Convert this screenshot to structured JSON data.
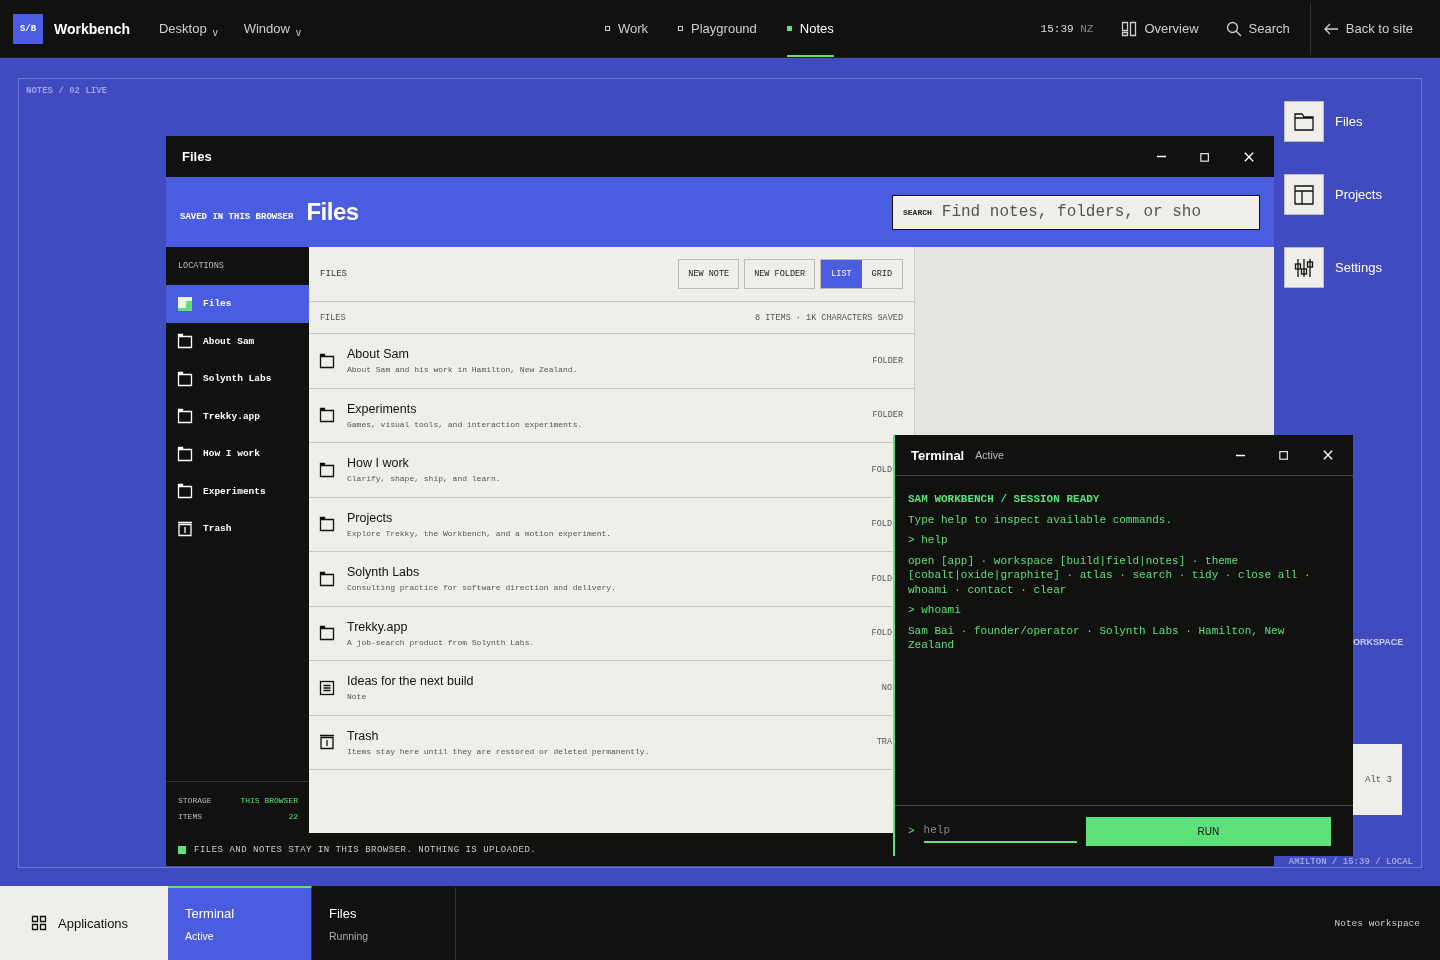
{
  "topbar": {
    "logo": "S/B",
    "title": "Workbench",
    "menus": [
      {
        "label": "Desktop",
        "caret": "v"
      },
      {
        "label": "Window",
        "caret": "v"
      }
    ],
    "nav": [
      {
        "label": "Work",
        "selected": false
      },
      {
        "label": "Playground",
        "selected": false
      },
      {
        "label": "Notes",
        "selected": true
      }
    ],
    "clock": {
      "time": "15:39",
      "zone": "NZ"
    },
    "actions": [
      {
        "label": "Overview",
        "kind": "overview"
      },
      {
        "label": "Search",
        "kind": "search"
      },
      {
        "label": "Back to site",
        "kind": "back"
      }
    ]
  },
  "desktop": {
    "breadcrumb": "NOTES / 02 LIVE",
    "icons": [
      {
        "label": "Files",
        "kind": "folder"
      },
      {
        "label": "Projects",
        "kind": "layout"
      },
      {
        "label": "Settings",
        "kind": "sliders"
      }
    ],
    "cut_label": "ORKSPACE",
    "shortcut": "Alt 3",
    "footer": "AMILTON / 15:39 / LOCAL"
  },
  "files_window": {
    "title": "Files",
    "eyebrow": "SAVED IN THIS BROWSER",
    "heading": "Files",
    "search": {
      "label": "SEARCH",
      "placeholder": "Find notes, folders, or sho"
    },
    "sidebar": {
      "heading": "LOCATIONS",
      "items": [
        {
          "label": "Files",
          "kind": "files",
          "selected": true
        },
        {
          "label": "About Sam",
          "kind": "folder",
          "selected": false
        },
        {
          "label": "Solynth Labs",
          "kind": "folder",
          "selected": false
        },
        {
          "label": "Trekky.app",
          "kind": "folder",
          "selected": false
        },
        {
          "label": "How I work",
          "kind": "folder",
          "selected": false
        },
        {
          "label": "Experiments",
          "kind": "folder",
          "selected": false
        },
        {
          "label": "Trash",
          "kind": "trash",
          "selected": false
        }
      ],
      "storage": [
        {
          "label": "STORAGE",
          "value": "THIS BROWSER"
        },
        {
          "label": "ITEMS",
          "value": "22"
        }
      ]
    },
    "toolbar": {
      "title": "FILES",
      "buttons": [
        "NEW NOTE",
        "NEW FOLDER"
      ],
      "views": [
        {
          "label": "LIST",
          "selected": true
        },
        {
          "label": "GRID",
          "selected": false
        }
      ]
    },
    "list_header": {
      "title": "FILES",
      "summary": "8 ITEMS · 1K CHARACTERS SAVED"
    },
    "rows": [
      {
        "name": "About Sam",
        "description": "About Sam and his work in Hamilton, New Zealand.",
        "type": "FOLDER",
        "kind": "folder",
        "clipped": false
      },
      {
        "name": "Experiments",
        "description": "Games, visual tools, and interaction experiments.",
        "type": "FOLDER",
        "kind": "folder",
        "clipped": false
      },
      {
        "name": "How I work",
        "description": "Clarify, shape, ship, and learn.",
        "type": "FOLD",
        "kind": "folder",
        "clipped": true
      },
      {
        "name": "Projects",
        "description": "Explore Trekky, the Workbench, and a motion experiment.",
        "type": "FOLD",
        "kind": "folder",
        "clipped": true
      },
      {
        "name": "Solynth Labs",
        "description": "Consulting practice for software direction and delivery.",
        "type": "FOLD",
        "kind": "folder",
        "clipped": true
      },
      {
        "name": "Trekky.app",
        "description": "A job-search product from Solynth Labs.",
        "type": "FOLD",
        "kind": "folder",
        "clipped": true
      },
      {
        "name": "Ideas for the next build",
        "description": "Note",
        "type": "NO",
        "kind": "note",
        "clipped": true
      },
      {
        "name": "Trash",
        "description": "Items stay here until they are restored or deleted permanently.",
        "type": "TRA",
        "kind": "trash",
        "clipped": true
      }
    ],
    "status": "FILES AND NOTES STAY IN THIS BROWSER. NOTHING IS UPLOADED."
  },
  "terminal": {
    "title": "Terminal",
    "status": "Active",
    "lines": [
      {
        "kind": "heading",
        "text": "SAM WORKBENCH / SESSION READY"
      },
      {
        "kind": "text",
        "text": "Type help to inspect available commands."
      },
      {
        "kind": "command",
        "text": "> help"
      },
      {
        "kind": "text",
        "text": "open [app] · workspace [build|field|notes] · theme [cobalt|oxide|graphite] · atlas · search · tidy · close all · whoami · contact · clear"
      },
      {
        "kind": "command",
        "text": "> whoami"
      },
      {
        "kind": "text",
        "text": "Sam Bai · founder/operator · Solynth Labs · Hamilton, New Zealand"
      }
    ],
    "prompt": ">",
    "input": {
      "placeholder": "help"
    },
    "run": "RUN"
  },
  "taskbar": {
    "apps": "Applications",
    "tasks": [
      {
        "name": "Terminal",
        "status": "Active",
        "selected": true
      },
      {
        "name": "Files",
        "status": "Running",
        "selected": false
      }
    ],
    "workspace": "Notes workspace"
  }
}
